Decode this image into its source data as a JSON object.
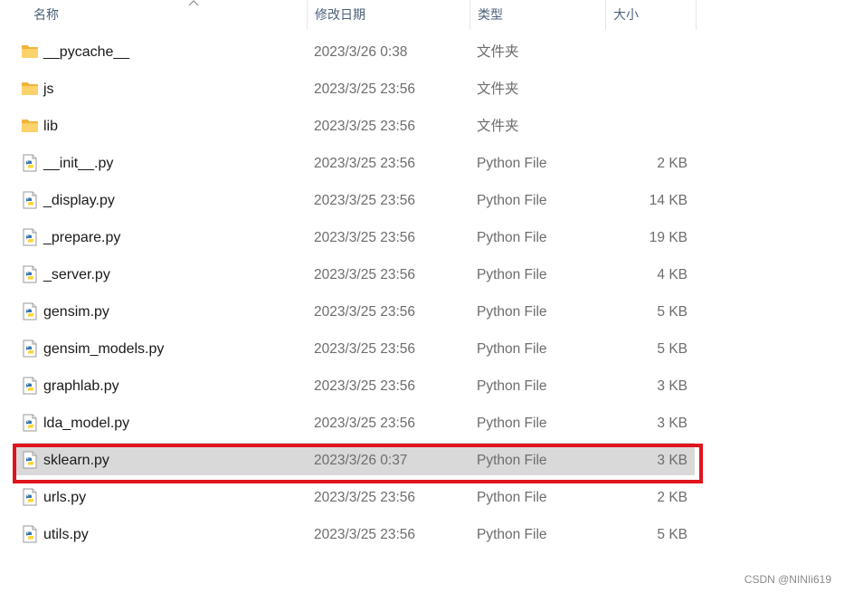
{
  "columns": {
    "name": "名称",
    "date": "修改日期",
    "type": "类型",
    "size": "大小"
  },
  "files": [
    {
      "name": "__pycache__",
      "date": "2023/3/26 0:38",
      "type": "文件夹",
      "size": "",
      "icon": "folder-icon"
    },
    {
      "name": "js",
      "date": "2023/3/25 23:56",
      "type": "文件夹",
      "size": "",
      "icon": "folder-icon"
    },
    {
      "name": "lib",
      "date": "2023/3/25 23:56",
      "type": "文件夹",
      "size": "",
      "icon": "folder-icon"
    },
    {
      "name": "__init__.py",
      "date": "2023/3/25 23:56",
      "type": "Python File",
      "size": "2 KB",
      "icon": "python-file-icon"
    },
    {
      "name": "_display.py",
      "date": "2023/3/25 23:56",
      "type": "Python File",
      "size": "14 KB",
      "icon": "python-file-icon"
    },
    {
      "name": "_prepare.py",
      "date": "2023/3/25 23:56",
      "type": "Python File",
      "size": "19 KB",
      "icon": "python-file-icon"
    },
    {
      "name": "_server.py",
      "date": "2023/3/25 23:56",
      "type": "Python File",
      "size": "4 KB",
      "icon": "python-file-icon"
    },
    {
      "name": "gensim.py",
      "date": "2023/3/25 23:56",
      "type": "Python File",
      "size": "5 KB",
      "icon": "python-file-icon"
    },
    {
      "name": "gensim_models.py",
      "date": "2023/3/25 23:56",
      "type": "Python File",
      "size": "5 KB",
      "icon": "python-file-icon"
    },
    {
      "name": "graphlab.py",
      "date": "2023/3/25 23:56",
      "type": "Python File",
      "size": "3 KB",
      "icon": "python-file-icon"
    },
    {
      "name": "lda_model.py",
      "date": "2023/3/25 23:56",
      "type": "Python File",
      "size": "3 KB",
      "icon": "python-file-icon"
    },
    {
      "name": "sklearn.py",
      "date": "2023/3/26 0:37",
      "type": "Python File",
      "size": "3 KB",
      "icon": "python-file-icon",
      "selected": true
    },
    {
      "name": "urls.py",
      "date": "2023/3/25 23:56",
      "type": "Python File",
      "size": "2 KB",
      "icon": "python-file-icon"
    },
    {
      "name": "utils.py",
      "date": "2023/3/25 23:56",
      "type": "Python File",
      "size": "5 KB",
      "icon": "python-file-icon"
    }
  ],
  "watermark": "CSDN @NINIi619",
  "colors": {
    "selection": "#d9d9d9",
    "highlight_border": "#e0141c",
    "folder": "#f8c44d",
    "header_text": "#4c607a"
  }
}
